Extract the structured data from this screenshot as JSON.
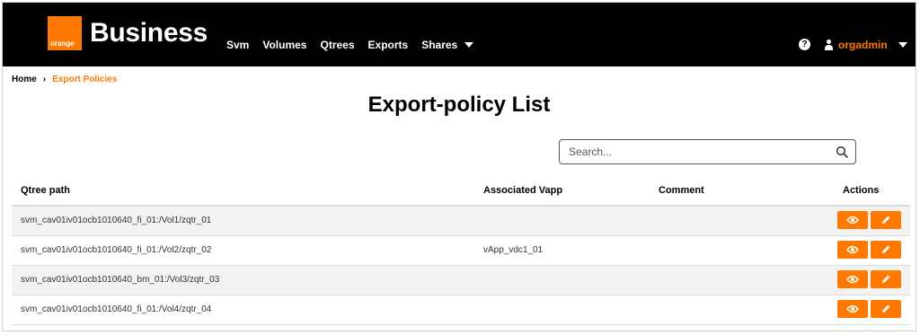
{
  "header": {
    "logo_text": "orange",
    "brand": "Business",
    "nav": [
      "Svm",
      "Volumes",
      "Qtrees",
      "Exports",
      "Shares"
    ],
    "help_icon": "?",
    "user": "orgadmin",
    "colors": {
      "accent": "#ff7900",
      "bar": "#000000"
    }
  },
  "breadcrumb": {
    "home": "Home",
    "separator": "›",
    "current": "Export Policies"
  },
  "page": {
    "title": "Export-policy List"
  },
  "search": {
    "placeholder": "Search..."
  },
  "table": {
    "columns": [
      "Qtree path",
      "Associated Vapp",
      "Comment",
      "Actions"
    ],
    "rows": [
      {
        "path": "svm_cav01iv01ocb1010640_fi_01:/Vol1/zqtr_01",
        "vapp": "",
        "comment": ""
      },
      {
        "path": "svm_cav01iv01ocb1010640_fi_01:/Vol2/zqtr_02",
        "vapp": "vApp_vdc1_01",
        "comment": ""
      },
      {
        "path": "svm_cav01iv01ocb1010640_bm_01:/Vol3/zqtr_03",
        "vapp": "",
        "comment": ""
      },
      {
        "path": "svm_cav01iv01ocb1010640_fi_01:/Vol4/zqtr_04",
        "vapp": "",
        "comment": ""
      }
    ],
    "action_icons": [
      "eye-icon",
      "pencil-icon"
    ]
  }
}
